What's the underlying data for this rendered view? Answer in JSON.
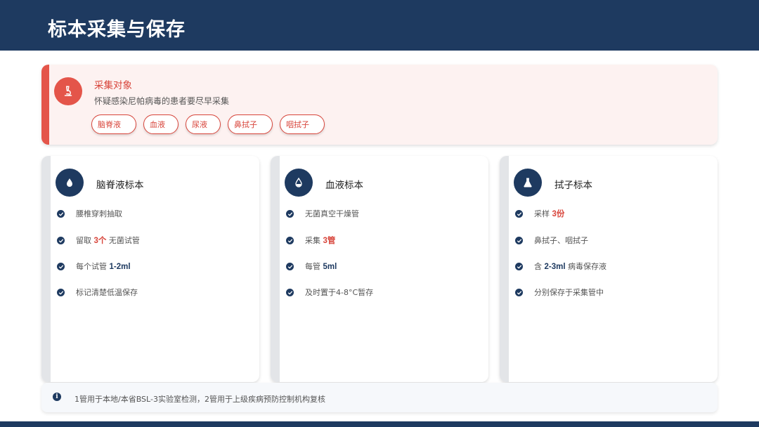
{
  "header": {
    "title": "标本采集与保存"
  },
  "target": {
    "heading": "采集对象",
    "description": "怀疑感染尼帕病毒的患者要尽早采集",
    "icon": "microscope-icon",
    "chips": [
      "脑脊液",
      "血液",
      "尿液",
      "鼻拭子",
      "咽拭子"
    ]
  },
  "cards": [
    {
      "title": "脑脊液标本",
      "icon": "droplet-icon",
      "items": [
        {
          "parts": [
            {
              "t": "腰椎穿刺抽取"
            }
          ]
        },
        {
          "parts": [
            {
              "t": "留取 "
            },
            {
              "t": "3个",
              "hl": "red"
            },
            {
              "t": " 无菌试管"
            }
          ]
        },
        {
          "parts": [
            {
              "t": "每个试管 "
            },
            {
              "t": "1-2ml",
              "hl": "navy"
            }
          ]
        },
        {
          "parts": [
            {
              "t": "标记清楚低温保存"
            }
          ]
        }
      ]
    },
    {
      "title": "血液标本",
      "icon": "blood-drop-icon",
      "items": [
        {
          "parts": [
            {
              "t": "无菌真空干燥管"
            }
          ]
        },
        {
          "parts": [
            {
              "t": "采集 "
            },
            {
              "t": "3管",
              "hl": "red"
            }
          ]
        },
        {
          "parts": [
            {
              "t": "每管 "
            },
            {
              "t": "5ml",
              "hl": "navy"
            }
          ]
        },
        {
          "parts": [
            {
              "t": "及时置于4-8°C暂存"
            }
          ]
        }
      ]
    },
    {
      "title": "拭子标本",
      "icon": "flask-icon",
      "items": [
        {
          "parts": [
            {
              "t": "采样 "
            },
            {
              "t": "3份",
              "hl": "red"
            }
          ]
        },
        {
          "parts": [
            {
              "t": "鼻拭子、咽拭子"
            }
          ]
        },
        {
          "parts": [
            {
              "t": "含 "
            },
            {
              "t": "2-3ml",
              "hl": "navy"
            },
            {
              "t": " 病毒保存液"
            }
          ]
        },
        {
          "parts": [
            {
              "t": "分别保存于采集管中"
            }
          ]
        }
      ]
    }
  ],
  "note": {
    "icon": "info-icon",
    "text": "1管用于本地/本省BSL-3实验室检测，2管用于上级疾病预防控制机构复核"
  },
  "colors": {
    "navy": "#1e3a60",
    "red": "#d8453b",
    "pink_bg": "#fdf2f1"
  }
}
